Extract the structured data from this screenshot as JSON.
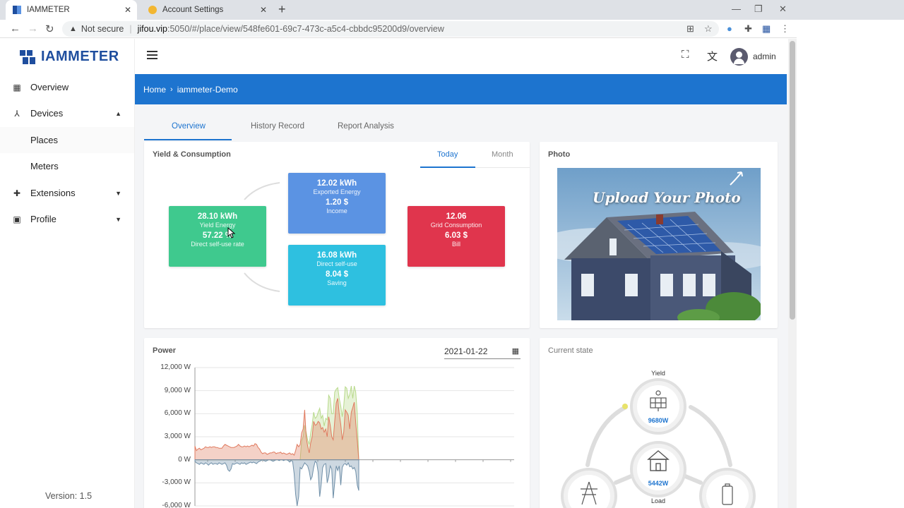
{
  "browser": {
    "tabs": [
      {
        "title": "IAMMETER",
        "active": true
      },
      {
        "title": "Account Settings",
        "active": false
      }
    ],
    "address": {
      "security": "Not secure",
      "host": "jifou.vip",
      "path": ":5050/#/place/view/548fe601-69c7-473c-a5c4-cbbdc95200d9/overview"
    }
  },
  "app": {
    "logo_text": "IAMMETER",
    "version": "Version: 1.5",
    "user": "admin"
  },
  "sidebar": {
    "items": [
      {
        "label": "Overview",
        "icon": "dashboard-icon"
      },
      {
        "label": "Devices",
        "icon": "devices-icon",
        "expanded": true
      },
      {
        "label": "Places",
        "sub": true
      },
      {
        "label": "Meters",
        "sub": true
      },
      {
        "label": "Extensions",
        "icon": "puzzle-icon"
      },
      {
        "label": "Profile",
        "icon": "profile-icon"
      }
    ]
  },
  "breadcrumb": {
    "home": "Home",
    "current": "iammeter-Demo"
  },
  "page_tabs": [
    "Overview",
    "History Record",
    "Report Analysis"
  ],
  "yield_card": {
    "title": "Yield & Consumption",
    "periods": [
      "Today",
      "Month"
    ],
    "yield": {
      "value": "28.10 kWh",
      "label": "Yield Energy",
      "rate": "57.22 %",
      "rate_label": "Direct self-use rate"
    },
    "exported": {
      "value": "12.02 kWh",
      "label": "Exported Energy",
      "money": "1.20 $",
      "money_label": "Income"
    },
    "selfuse": {
      "value": "16.08 kWh",
      "label": "Direct self-use",
      "money": "8.04 $",
      "money_label": "Saving"
    },
    "grid": {
      "value": "12.06",
      "label": "Grid Consumption",
      "money": "6.03 $",
      "money_label": "Bill"
    },
    "colors": {
      "yield": "#3fc98e",
      "exported": "#5b93e3",
      "selfuse": "#2ec0e0",
      "grid": "#e0354d"
    }
  },
  "photo_card": {
    "title": "Photo",
    "overlay_text": "Upload Your Photo"
  },
  "power_card": {
    "title": "Power",
    "date": "2021-01-22",
    "y_ticks": [
      "12,000 W",
      "9,000 W",
      "6,000 W",
      "3,000 W",
      "0 W",
      "-3,000 W",
      "-6,000 W"
    ]
  },
  "current_state": {
    "title": "Current state",
    "yield_label": "Yield",
    "yield_value": "9680W",
    "load_label": "Load",
    "load_value": "5442W"
  },
  "chart_data": {
    "type": "area",
    "title": "Power",
    "ylim": [
      -6000,
      12000
    ],
    "y_ticks": [
      12000,
      9000,
      6000,
      3000,
      0,
      -3000,
      -6000
    ],
    "series": [
      {
        "color": "#e07a5f",
        "values": [
          1800,
          1200,
          1400,
          1500,
          1300,
          1400,
          1500,
          1700,
          1600,
          1600,
          1700,
          1600,
          1700,
          1700,
          1600,
          1600,
          1500,
          1500,
          1500,
          1800,
          2000,
          1900,
          1800,
          1700,
          1600,
          1600,
          1600,
          1700,
          1800,
          2000,
          1800,
          1700,
          1700,
          1800,
          1700,
          1800,
          1700,
          1800,
          1900,
          1800,
          2100,
          2000,
          1600,
          1400,
          1000,
          800,
          900,
          900,
          700,
          800,
          900,
          900,
          1000,
          1000,
          800,
          900,
          900,
          1000,
          800,
          900,
          800,
          700,
          800,
          900,
          700,
          800,
          600,
          1200,
          2000,
          1700,
          2000,
          3500,
          4000,
          6500,
          3000,
          1800,
          900,
          2200,
          3000,
          5000,
          4500,
          4600,
          5000,
          4800,
          4000,
          4200,
          3600,
          4000,
          3000,
          5600,
          4500,
          3000,
          2600,
          5000,
          7400,
          8000,
          6000,
          4600,
          2600,
          3600,
          6500,
          6200,
          5800,
          4000,
          6200,
          6800,
          7500,
          4800,
          2500,
          0
        ]
      },
      {
        "color": "#b7d98a",
        "values": [
          0,
          0,
          0,
          0,
          0,
          0,
          0,
          0,
          0,
          0,
          0,
          0,
          0,
          0,
          0,
          0,
          0,
          0,
          0,
          0,
          0,
          0,
          0,
          0,
          0,
          0,
          0,
          0,
          0,
          0,
          0,
          0,
          0,
          0,
          0,
          0,
          0,
          0,
          0,
          0,
          0,
          0,
          0,
          0,
          0,
          0,
          0,
          0,
          0,
          0,
          0,
          0,
          0,
          0,
          0,
          0,
          0,
          0,
          0,
          0,
          0,
          0,
          0,
          0,
          0,
          0,
          0,
          0,
          0,
          0,
          0,
          2500,
          3000,
          4500,
          3600,
          2600,
          2000,
          3500,
          4600,
          6200,
          5400,
          5600,
          6200,
          6700,
          5400,
          5800,
          4400,
          5400,
          5200,
          8400,
          8000,
          6000,
          6000,
          8800,
          9200,
          9400,
          8000,
          7000,
          5600,
          7000,
          9500,
          9300,
          8000,
          8500,
          9600,
          8000,
          9600,
          8800,
          6000,
          0
        ]
      },
      {
        "color": "#6f8fa8",
        "values": [
          -200,
          -400,
          -500,
          -600,
          -400,
          -500,
          -600,
          -400,
          -500,
          -700,
          -500,
          -400,
          -600,
          -500,
          -500,
          -600,
          -400,
          -500,
          -600,
          -500,
          -400,
          -700,
          -1300,
          -1500,
          -1200,
          -500,
          -600,
          -500,
          -400,
          -500,
          -600,
          -400,
          -500,
          -400,
          -600,
          -500,
          -400,
          -300,
          -400,
          -300,
          -400,
          -500,
          -300,
          -200,
          -100,
          0,
          -100,
          -200,
          -100,
          0,
          0,
          -100,
          -200,
          -100,
          0,
          0,
          -100,
          0,
          0,
          -100,
          0,
          0,
          -100,
          -300,
          -100,
          -200,
          -1800,
          -4500,
          -6000,
          -4800,
          -1000,
          -1200,
          -800,
          -400,
          -600,
          -800,
          -1500,
          -2600,
          -2200,
          -1000,
          -200,
          -400,
          -1600,
          -4800,
          -3200,
          -1000,
          -600,
          -500,
          -3000,
          -2200,
          -800,
          -1200,
          -5000,
          -3000,
          -800,
          -1400,
          -800,
          -3300,
          -1000,
          -600,
          -500,
          -700,
          -400,
          -900,
          -800,
          -1200,
          -1000,
          -1500,
          -3300,
          -4000
        ]
      }
    ]
  }
}
